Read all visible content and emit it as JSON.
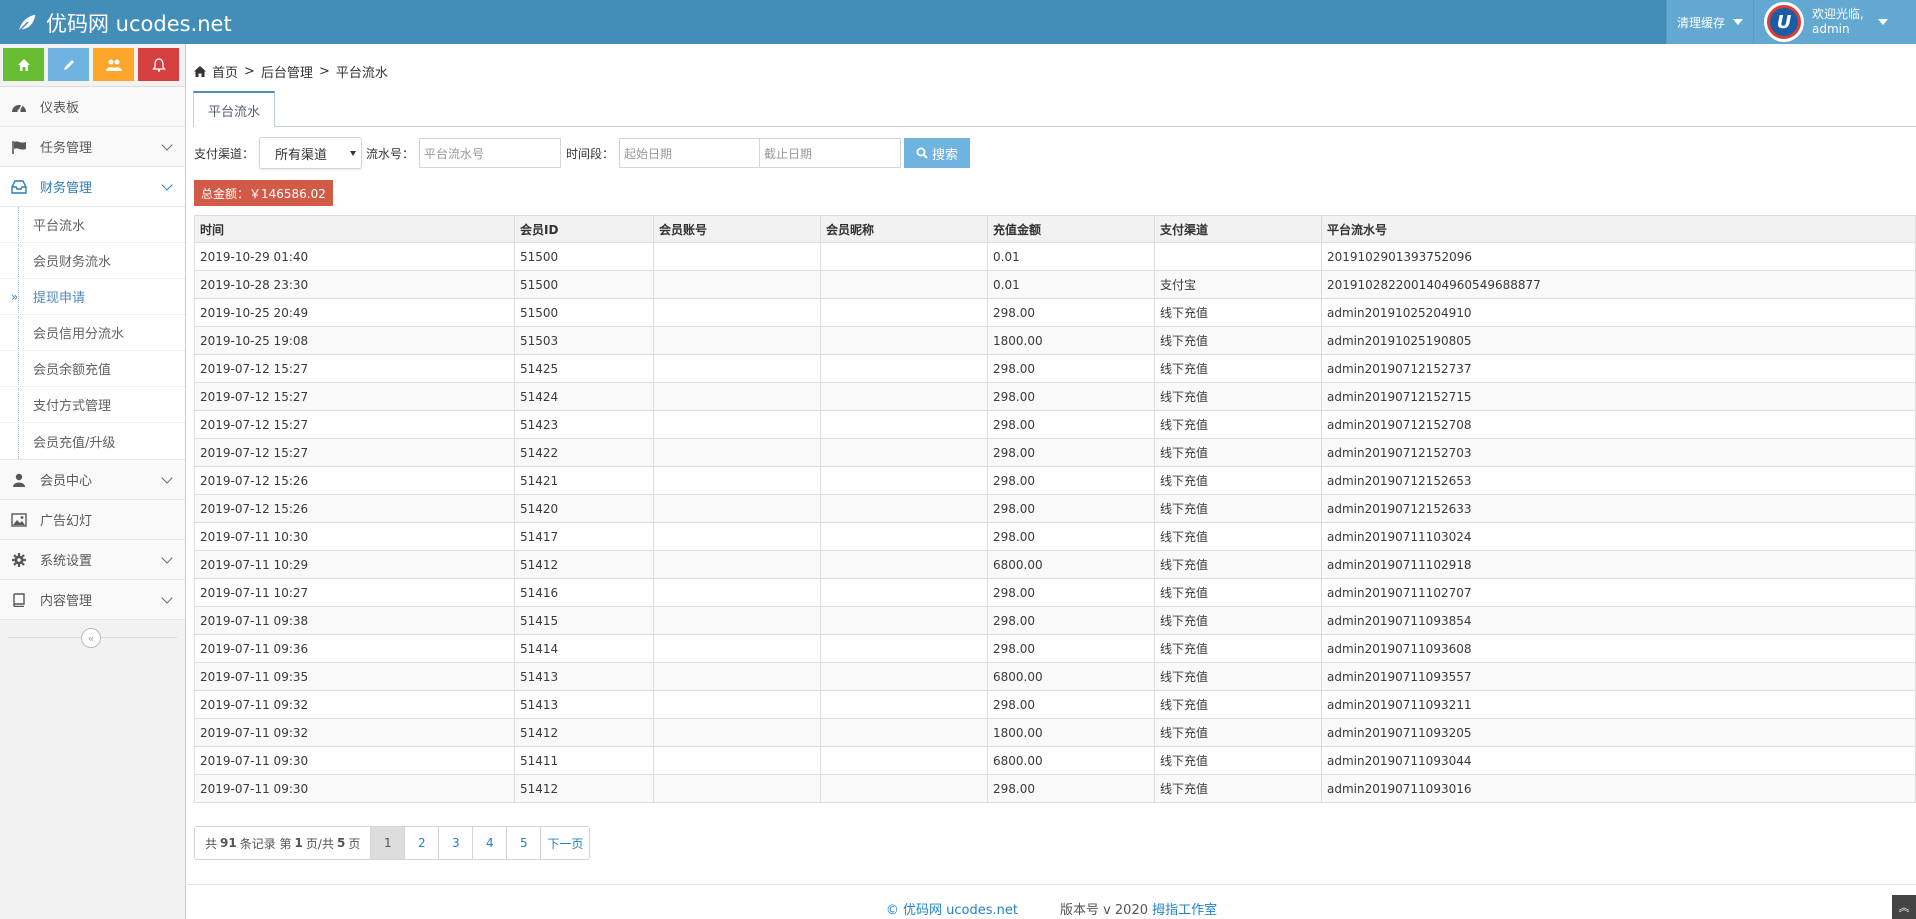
{
  "brand": {
    "name": "优码网 ucodes.net"
  },
  "navbar": {
    "clear_cache": "清理缓存",
    "welcome": "欢迎光临,",
    "username": "admin",
    "avatar_letter": "U"
  },
  "colors": {
    "navbar": "#438eb9",
    "accent": "#6fb3e0",
    "badge": "#d15b47"
  },
  "sidebar": {
    "shortcuts": [
      {
        "icon": "home-icon",
        "color": "#68bc31"
      },
      {
        "icon": "pencil-icon",
        "color": "#6fb3e0"
      },
      {
        "icon": "users-icon",
        "color": "#fea62b"
      },
      {
        "icon": "bell-icon",
        "color": "#d53f40"
      }
    ],
    "dashboard": "仪表板",
    "task_mgmt": "任务管理",
    "finance_mgmt": "财务管理",
    "finance_sub": [
      "平台流水",
      "会员财务流水",
      "提现申请",
      "会员信用分流水",
      "会员余额充值",
      "支付方式管理",
      "会员充值/升级"
    ],
    "member_center": "会员中心",
    "ads": "广告幻灯",
    "system_settings": "系统设置",
    "content_mgmt": "内容管理"
  },
  "breadcrumb": {
    "home": "首页",
    "sep": ">",
    "level1": "后台管理",
    "current": "平台流水"
  },
  "tab": {
    "label": "平台流水"
  },
  "filters": {
    "channel_label": "支付渠道：",
    "channel_value": "所有渠道",
    "serial_label": "流水号：",
    "serial_placeholder": "平台流水号",
    "period_label": "时间段：",
    "start_placeholder": "起始日期",
    "end_placeholder": "截止日期",
    "search_label": "搜索"
  },
  "total": {
    "label": "总金额：￥146586.02"
  },
  "table": {
    "headers": [
      "时间",
      "会员ID",
      "会员账号",
      "会员昵称",
      "充值金额",
      "支付渠道",
      "平台流水号"
    ],
    "rows": [
      [
        "2019-10-29 01:40",
        "51500",
        "",
        "",
        "0.01",
        "",
        "2019102901393752096"
      ],
      [
        "2019-10-28 23:30",
        "51500",
        "",
        "",
        "0.01",
        "支付宝",
        "2019102822001404960549688877"
      ],
      [
        "2019-10-25 20:49",
        "51500",
        "",
        "",
        "298.00",
        "线下充值",
        "admin20191025204910"
      ],
      [
        "2019-10-25 19:08",
        "51503",
        "",
        "",
        "1800.00",
        "线下充值",
        "admin20191025190805"
      ],
      [
        "2019-07-12 15:27",
        "51425",
        "",
        "",
        "298.00",
        "线下充值",
        "admin20190712152737"
      ],
      [
        "2019-07-12 15:27",
        "51424",
        "",
        "",
        "298.00",
        "线下充值",
        "admin20190712152715"
      ],
      [
        "2019-07-12 15:27",
        "51423",
        "",
        "",
        "298.00",
        "线下充值",
        "admin20190712152708"
      ],
      [
        "2019-07-12 15:27",
        "51422",
        "",
        "",
        "298.00",
        "线下充值",
        "admin20190712152703"
      ],
      [
        "2019-07-12 15:26",
        "51421",
        "",
        "",
        "298.00",
        "线下充值",
        "admin20190712152653"
      ],
      [
        "2019-07-12 15:26",
        "51420",
        "",
        "",
        "298.00",
        "线下充值",
        "admin20190712152633"
      ],
      [
        "2019-07-11 10:30",
        "51417",
        "",
        "",
        "298.00",
        "线下充值",
        "admin20190711103024"
      ],
      [
        "2019-07-11 10:29",
        "51412",
        "",
        "",
        "6800.00",
        "线下充值",
        "admin20190711102918"
      ],
      [
        "2019-07-11 10:27",
        "51416",
        "",
        "",
        "298.00",
        "线下充值",
        "admin20190711102707"
      ],
      [
        "2019-07-11 09:38",
        "51415",
        "",
        "",
        "298.00",
        "线下充值",
        "admin20190711093854"
      ],
      [
        "2019-07-11 09:36",
        "51414",
        "",
        "",
        "298.00",
        "线下充值",
        "admin20190711093608"
      ],
      [
        "2019-07-11 09:35",
        "51413",
        "",
        "",
        "6800.00",
        "线下充值",
        "admin20190711093557"
      ],
      [
        "2019-07-11 09:32",
        "51413",
        "",
        "",
        "298.00",
        "线下充值",
        "admin20190711093211"
      ],
      [
        "2019-07-11 09:32",
        "51412",
        "",
        "",
        "1800.00",
        "线下充值",
        "admin20190711093205"
      ],
      [
        "2019-07-11 09:30",
        "51411",
        "",
        "",
        "6800.00",
        "线下充值",
        "admin20190711093044"
      ],
      [
        "2019-07-11 09:30",
        "51412",
        "",
        "",
        "298.00",
        "线下充值",
        "admin20190711093016"
      ]
    ]
  },
  "pagination": {
    "pre": "共",
    "total_records": "91",
    "mid1": "条记录 第",
    "current_page": "1",
    "mid2": "页/共",
    "total_pages": "5",
    "post": "页",
    "pages": [
      "1",
      "2",
      "3",
      "4",
      "5"
    ],
    "next": "下一页"
  },
  "footer": {
    "copyright": "© 优码网 ucodes.net",
    "version_label": "版本号 v 2020",
    "studio": "拇指工作室"
  }
}
